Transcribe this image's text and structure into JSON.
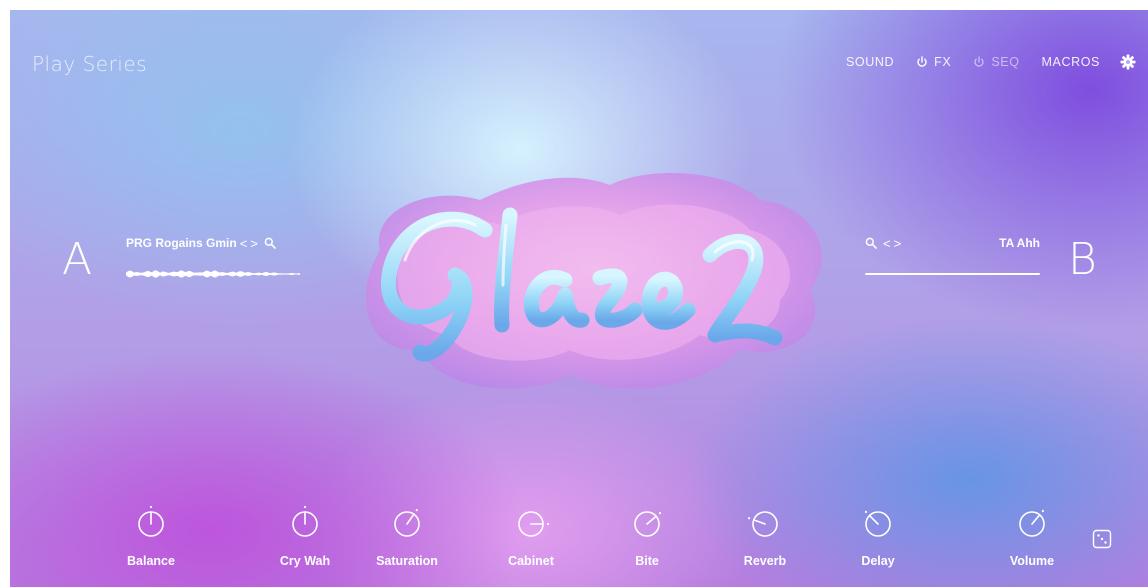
{
  "header": {
    "brand": "Play Series",
    "nav": [
      {
        "label": "SOUND",
        "power": false,
        "dim": false
      },
      {
        "label": "FX",
        "power": true,
        "dim": false
      },
      {
        "label": "SEQ",
        "power": true,
        "dim": true
      },
      {
        "label": "MACROS",
        "power": false,
        "dim": false
      }
    ],
    "settings_icon": "gear-icon"
  },
  "logo_text": "Glaze 2",
  "layer_a": {
    "letter": "A",
    "preset": "PRG Rogains Gmin",
    "prev_glyph": "<",
    "next_glyph": ">",
    "search_icon": "magnifier-icon"
  },
  "layer_b": {
    "letter": "B",
    "preset": "TA Ahh",
    "prev_glyph": "<",
    "next_glyph": ">",
    "search_icon": "magnifier-icon"
  },
  "knobs": [
    {
      "label": "Balance",
      "angle": 0
    },
    {
      "label": "Cry Wah",
      "angle": 0
    },
    {
      "label": "Saturation",
      "angle": 35
    },
    {
      "label": "Cabinet",
      "angle": 90
    },
    {
      "label": "Bite",
      "angle": 50
    },
    {
      "label": "Reverb",
      "angle": -70
    },
    {
      "label": "Delay",
      "angle": -45
    },
    {
      "label": "Volume",
      "angle": 40
    }
  ],
  "randomize_icon": "dice-icon",
  "colors": {
    "text": "#ffffff",
    "nav_dim": "rgba(255,255,255,0.55)"
  }
}
